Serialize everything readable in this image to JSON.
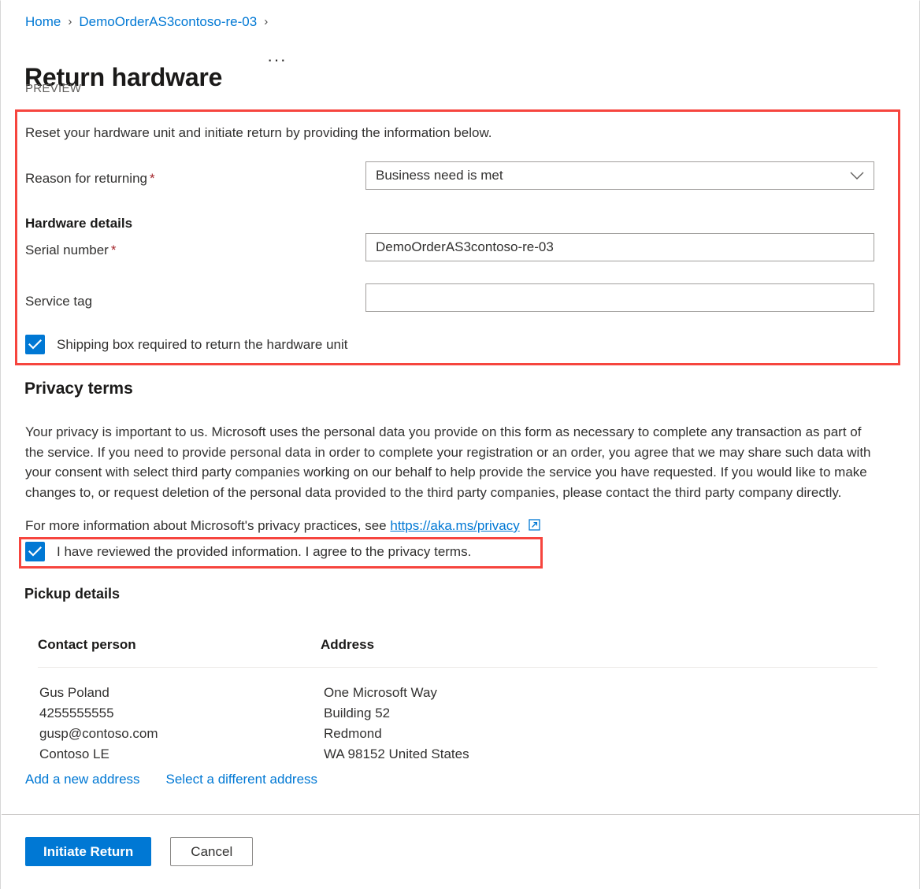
{
  "breadcrumb": {
    "items": [
      {
        "label": "Home"
      },
      {
        "label": "DemoOrderAS3contoso-re-03"
      }
    ],
    "separator": "›"
  },
  "header": {
    "title": "Return hardware",
    "more_actions": "···",
    "preview_tag": "PREVIEW"
  },
  "form": {
    "intro": "Reset your hardware unit and initiate return by providing the information below.",
    "reason": {
      "label": "Reason for returning",
      "required_marker": "*",
      "value": "Business need is met"
    },
    "hardware_details_heading": "Hardware details",
    "serial_number": {
      "label": "Serial number",
      "required_marker": "*",
      "value": "DemoOrderAS3contoso-re-03",
      "placeholder": ""
    },
    "service_tag": {
      "label": "Service tag",
      "value": "",
      "placeholder": ""
    },
    "shipping_box_checkbox": {
      "label": "Shipping box required to return the hardware unit",
      "checked": true,
      "mark": "✓"
    }
  },
  "privacy": {
    "heading": "Privacy terms",
    "paragraph": "Your privacy is important to us. Microsoft uses the personal data you provide on this form as necessary to complete any transaction as part of the service. If you need to provide personal data in order to complete your registration or an order, you agree that we may share such data with your consent with select third party companies working on our behalf to help provide the service you have requested. If you would like to make changes to, or request deletion of the personal data provided to the third party companies, please contact the third party company directly.",
    "more_info_prefix": "For more information about Microsoft's privacy practices, see",
    "link_text": "https://aka.ms/privacy",
    "external_icon": "external-link-icon",
    "agree_checkbox": {
      "label": "I have reviewed the provided information. I agree to the privacy terms.",
      "checked": true,
      "mark": "✓"
    }
  },
  "pickup": {
    "heading": "Pickup details",
    "columns": [
      "Contact person",
      "Address"
    ],
    "contact_person": [
      "Gus Poland",
      "4255555555",
      "gusp@contoso.com",
      "Contoso LE"
    ],
    "address": [
      "One Microsoft Way",
      "Building 52",
      "Redmond",
      "WA 98152 United States"
    ],
    "actions": [
      {
        "label": "Add a new address"
      },
      {
        "label": "Select a different address"
      }
    ]
  },
  "footer": {
    "primary_button": "Initiate Return",
    "secondary_button": "Cancel"
  },
  "colors": {
    "accent": "#0078d4",
    "highlight": "#f6453e",
    "required": "#a4262c",
    "text": "#323130"
  }
}
